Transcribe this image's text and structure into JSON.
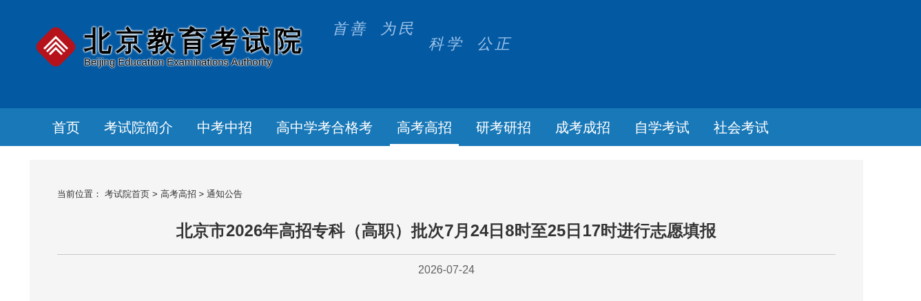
{
  "header": {
    "logo_title": "北京教育考试院",
    "logo_subtitle": "Beijing Education Examinations Authority",
    "slogans": [
      "首善",
      "为民",
      "科学",
      "公正"
    ]
  },
  "nav": [
    {
      "label": "首页",
      "selected": false
    },
    {
      "label": "考试院简介",
      "selected": false
    },
    {
      "label": "中考中招",
      "selected": false
    },
    {
      "label": "高中学考合格考",
      "selected": false
    },
    {
      "label": "高考高招",
      "selected": true
    },
    {
      "label": "研考研招",
      "selected": false
    },
    {
      "label": "成考成招",
      "selected": false
    },
    {
      "label": "自学考试",
      "selected": false
    },
    {
      "label": "社会考试",
      "selected": false
    }
  ],
  "breadcrumb": {
    "label": "当前位置：",
    "separator": ">",
    "items": [
      "考试院首页",
      "高考高招",
      "通知公告"
    ]
  },
  "article": {
    "title": "北京市2026年高招专科（高职）批次7月24日8时至25日17时进行志愿填报",
    "date": "2026-07-24"
  }
}
